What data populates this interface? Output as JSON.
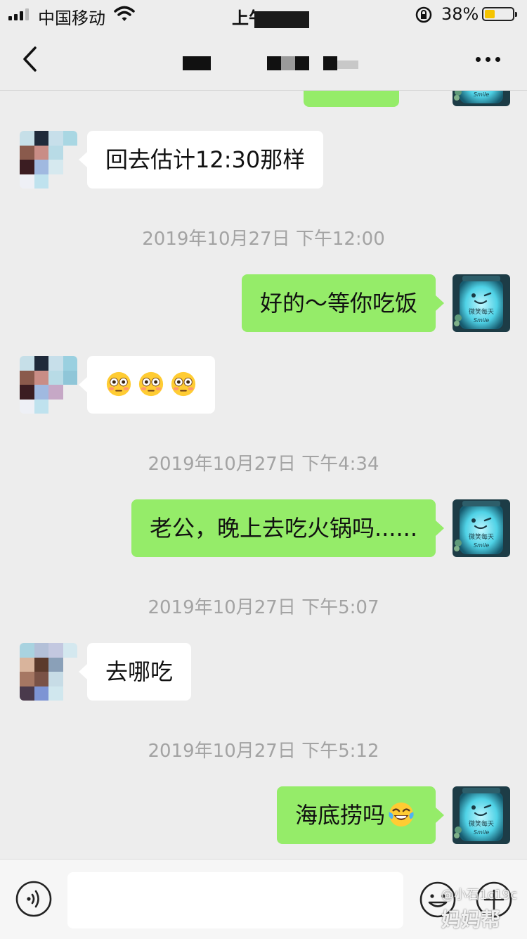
{
  "status_bar": {
    "carrier": "中国移动",
    "time": "上午9:03",
    "battery_percent": "38%",
    "battery_level": 0.38
  },
  "navbar": {
    "back_icon": "chevron-left-icon",
    "more_icon": "more-dots-icon"
  },
  "messages": [
    {
      "type": "text",
      "side": "left",
      "text": "回去估计12:30那样"
    },
    {
      "type": "timestamp",
      "text": "2019年10月27日 下午12:00"
    },
    {
      "type": "text",
      "side": "right",
      "text": "好的～等你吃饭"
    },
    {
      "type": "emoji",
      "side": "left",
      "emojis": [
        "flushed-face",
        "flushed-face",
        "flushed-face"
      ]
    },
    {
      "type": "timestamp",
      "text": "2019年10月27日 下午4:34"
    },
    {
      "type": "text",
      "side": "right",
      "text": "老公，晚上去吃火锅吗......"
    },
    {
      "type": "timestamp",
      "text": "2019年10月27日 下午5:07"
    },
    {
      "type": "text",
      "side": "left",
      "text": "去哪吃"
    },
    {
      "type": "timestamp",
      "text": "2019年10月27日 下午5:12"
    },
    {
      "type": "text",
      "side": "right",
      "text": "海底捞吗",
      "emoji": "tears-of-joy"
    }
  ],
  "right_avatar_text": {
    "line1": "微笑每天",
    "line2": "Smile"
  },
  "input_bar": {
    "voice_icon": "voice-icon",
    "emoji_icon": "emoji-icon",
    "plus_icon": "plus-icon",
    "value": ""
  },
  "watermark": {
    "line1": "@小石1c19c",
    "line2": "妈妈帮"
  },
  "colors": {
    "background": "#ededed",
    "bubble_mine": "#95ec69",
    "bubble_theirs": "#ffffff",
    "timestamp": "#a3a3a3",
    "battery": "#f5c400"
  }
}
